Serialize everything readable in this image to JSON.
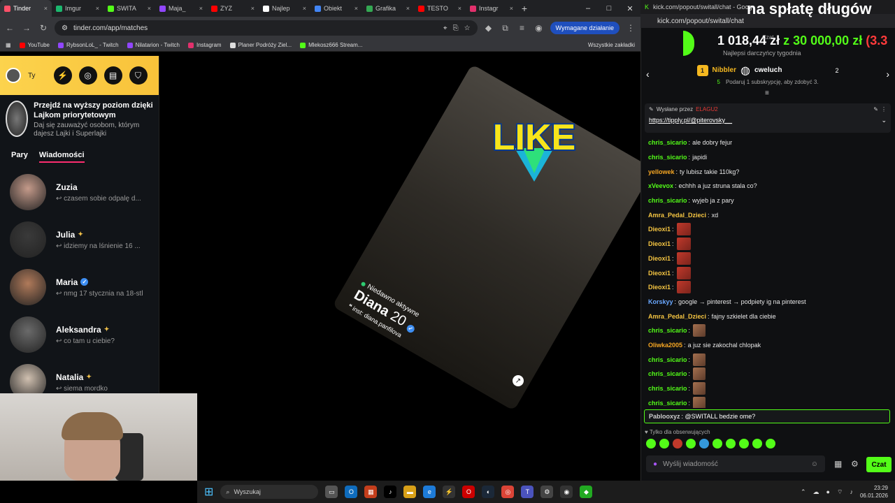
{
  "browser": {
    "tabs": [
      {
        "label": "Tinder",
        "color": "#fd5068"
      },
      {
        "label": "Imgur",
        "color": "#1bb76e"
      },
      {
        "label": "SWITA",
        "color": "#53fc18"
      },
      {
        "label": "Maja_",
        "color": "#9146ff"
      },
      {
        "label": "ZYZ",
        "color": "#ff0000"
      },
      {
        "label": "Najlep",
        "color": "#ffffff"
      },
      {
        "label": "Obiekt",
        "color": "#4285f4"
      },
      {
        "label": "Grafika",
        "color": "#34a853"
      },
      {
        "label": "TESTO",
        "color": "#ff0000"
      },
      {
        "label": "Instagr",
        "color": "#e1306c"
      }
    ],
    "url": "tinder.com/app/matches",
    "action_button": "Wymagane działanie",
    "bookmarks": [
      {
        "label": "YouTube",
        "color": "#ff0000"
      },
      {
        "label": "RybsonLoL_ - Twitch",
        "color": "#9146ff"
      },
      {
        "label": "Nilatarion - Twitch",
        "color": "#9146ff"
      },
      {
        "label": "Instagram",
        "color": "#e1306c"
      },
      {
        "label": "Planer Podróży Ziel...",
        "color": "#dddddd"
      },
      {
        "label": "Mleko​sz666 Stream...",
        "color": "#53fc18"
      }
    ],
    "all_bookmarks": "Wszystkie zakładki"
  },
  "tinder": {
    "me": "Ty",
    "promo_title": "Przejdź na wyższy poziom dzięki Lajkom priorytetowym",
    "promo_sub": "Daj się zauważyć osobom, którym dajesz Lajki i Superlajki",
    "tabs": {
      "pairs": "Pary",
      "messages": "Wiadomości"
    },
    "matches": [
      {
        "name": "Zuzia",
        "msg": "czasem sobie odpalę d...",
        "badge": ""
      },
      {
        "name": "Julia",
        "msg": "idziemy na lśnienie 16 ...",
        "badge": "gold"
      },
      {
        "name": "Maria",
        "msg": "nmg 17 stycznia na 18-stk...",
        "badge": "verified"
      },
      {
        "name": "Aleksandra",
        "msg": "co tam u ciebie?",
        "badge": "gold"
      },
      {
        "name": "Natalia",
        "msg": "siema mordko",
        "badge": "gold"
      }
    ],
    "card": {
      "stamp": "LIKE",
      "status": "Niedawno aktywne",
      "name": "Diana",
      "age": "20",
      "bio": "inst: diana.panfilova"
    }
  },
  "taskbar": {
    "search": "Wyszukaj",
    "time": "23:29",
    "date": "06.01.2026"
  },
  "kick": {
    "window_title": "kick.com/popout/switall/chat - Goog",
    "url": "kick.com/popout/switall/chat",
    "overlay_text": "na spłatę długów",
    "goal_current": "1 018,44 zł",
    "goal_sep": "z",
    "goal_total": "30 000,00 zł",
    "goal_extra": "(3.3",
    "goal_sub": "Najlepsi darczyńcy tygodnia",
    "goal_tag": "Czat",
    "top": {
      "rank": "1",
      "user": "Nibbler",
      "user_count": "5",
      "gifter": "cweluch",
      "gifter_count": "2",
      "hint": "Podaruj 1 subskrypcję, aby zdobyć 3."
    },
    "pinned": {
      "by": "Wysłane przez",
      "user": "ELAGU2",
      "link": "https://tipply.pl/@piterovsky__"
    },
    "messages": [
      {
        "user": "chris_sicario",
        "color": "#53fc18",
        "text": "ale dobry fejur",
        "emote": ""
      },
      {
        "user": "chris_sicario",
        "color": "#53fc18",
        "text": "japidi",
        "emote": ""
      },
      {
        "user": "yellowek",
        "color": "#f5a623",
        "text": "ty lubisz takie 110kg?",
        "emote": ""
      },
      {
        "user": "xVeevox",
        "color": "#53fc18",
        "text": "echhh a juz struna stala co?",
        "emote": ""
      },
      {
        "user": "chris_sicario",
        "color": "#53fc18",
        "text": "wyjeb ja z pary",
        "emote": ""
      },
      {
        "user": "Amra_Pedal_Dzieci",
        "color": "#f5c542",
        "text": "xd",
        "emote": ""
      },
      {
        "user": "Dieoxi1",
        "color": "#f5c542",
        "text": "",
        "emote": "red"
      },
      {
        "user": "Dieoxi1",
        "color": "#f5c542",
        "text": "",
        "emote": "red"
      },
      {
        "user": "Dieoxi1",
        "color": "#f5c542",
        "text": "",
        "emote": "red"
      },
      {
        "user": "Dieoxi1",
        "color": "#f5c542",
        "text": "",
        "emote": "red"
      },
      {
        "user": "Dieoxi1",
        "color": "#f5c542",
        "text": "",
        "emote": "red"
      },
      {
        "user": "Korskyy",
        "color": "#6aa8ff",
        "text": "google → pinterest → podpiety ig na pinterest",
        "emote": ""
      },
      {
        "user": "Amra_Pedal_Dzieci",
        "color": "#f5c542",
        "text": "fajny szkielet dla ciebie",
        "emote": ""
      },
      {
        "user": "chris_sicario",
        "color": "#53fc18",
        "text": "",
        "emote": "small"
      },
      {
        "user": "Oliwka2005",
        "color": "#f5a623",
        "text": "a juz sie zakochal chlopak",
        "emote": ""
      },
      {
        "user": "chris_sicario",
        "color": "#53fc18",
        "text": "",
        "emote": "small"
      },
      {
        "user": "chris_sicario",
        "color": "#53fc18",
        "text": "",
        "emote": "small"
      },
      {
        "user": "chris_sicario",
        "color": "#53fc18",
        "text": "",
        "emote": "small"
      },
      {
        "user": "chris_sicario",
        "color": "#53fc18",
        "text": "",
        "emote": "small"
      }
    ],
    "highlight": {
      "user": "Pablooxyz",
      "text": "@SWITALL bedzie ome?"
    },
    "followers_only": "Tylko dla obserwujących",
    "input_placeholder": "Wyślij wiadomość",
    "send": "Czat"
  }
}
